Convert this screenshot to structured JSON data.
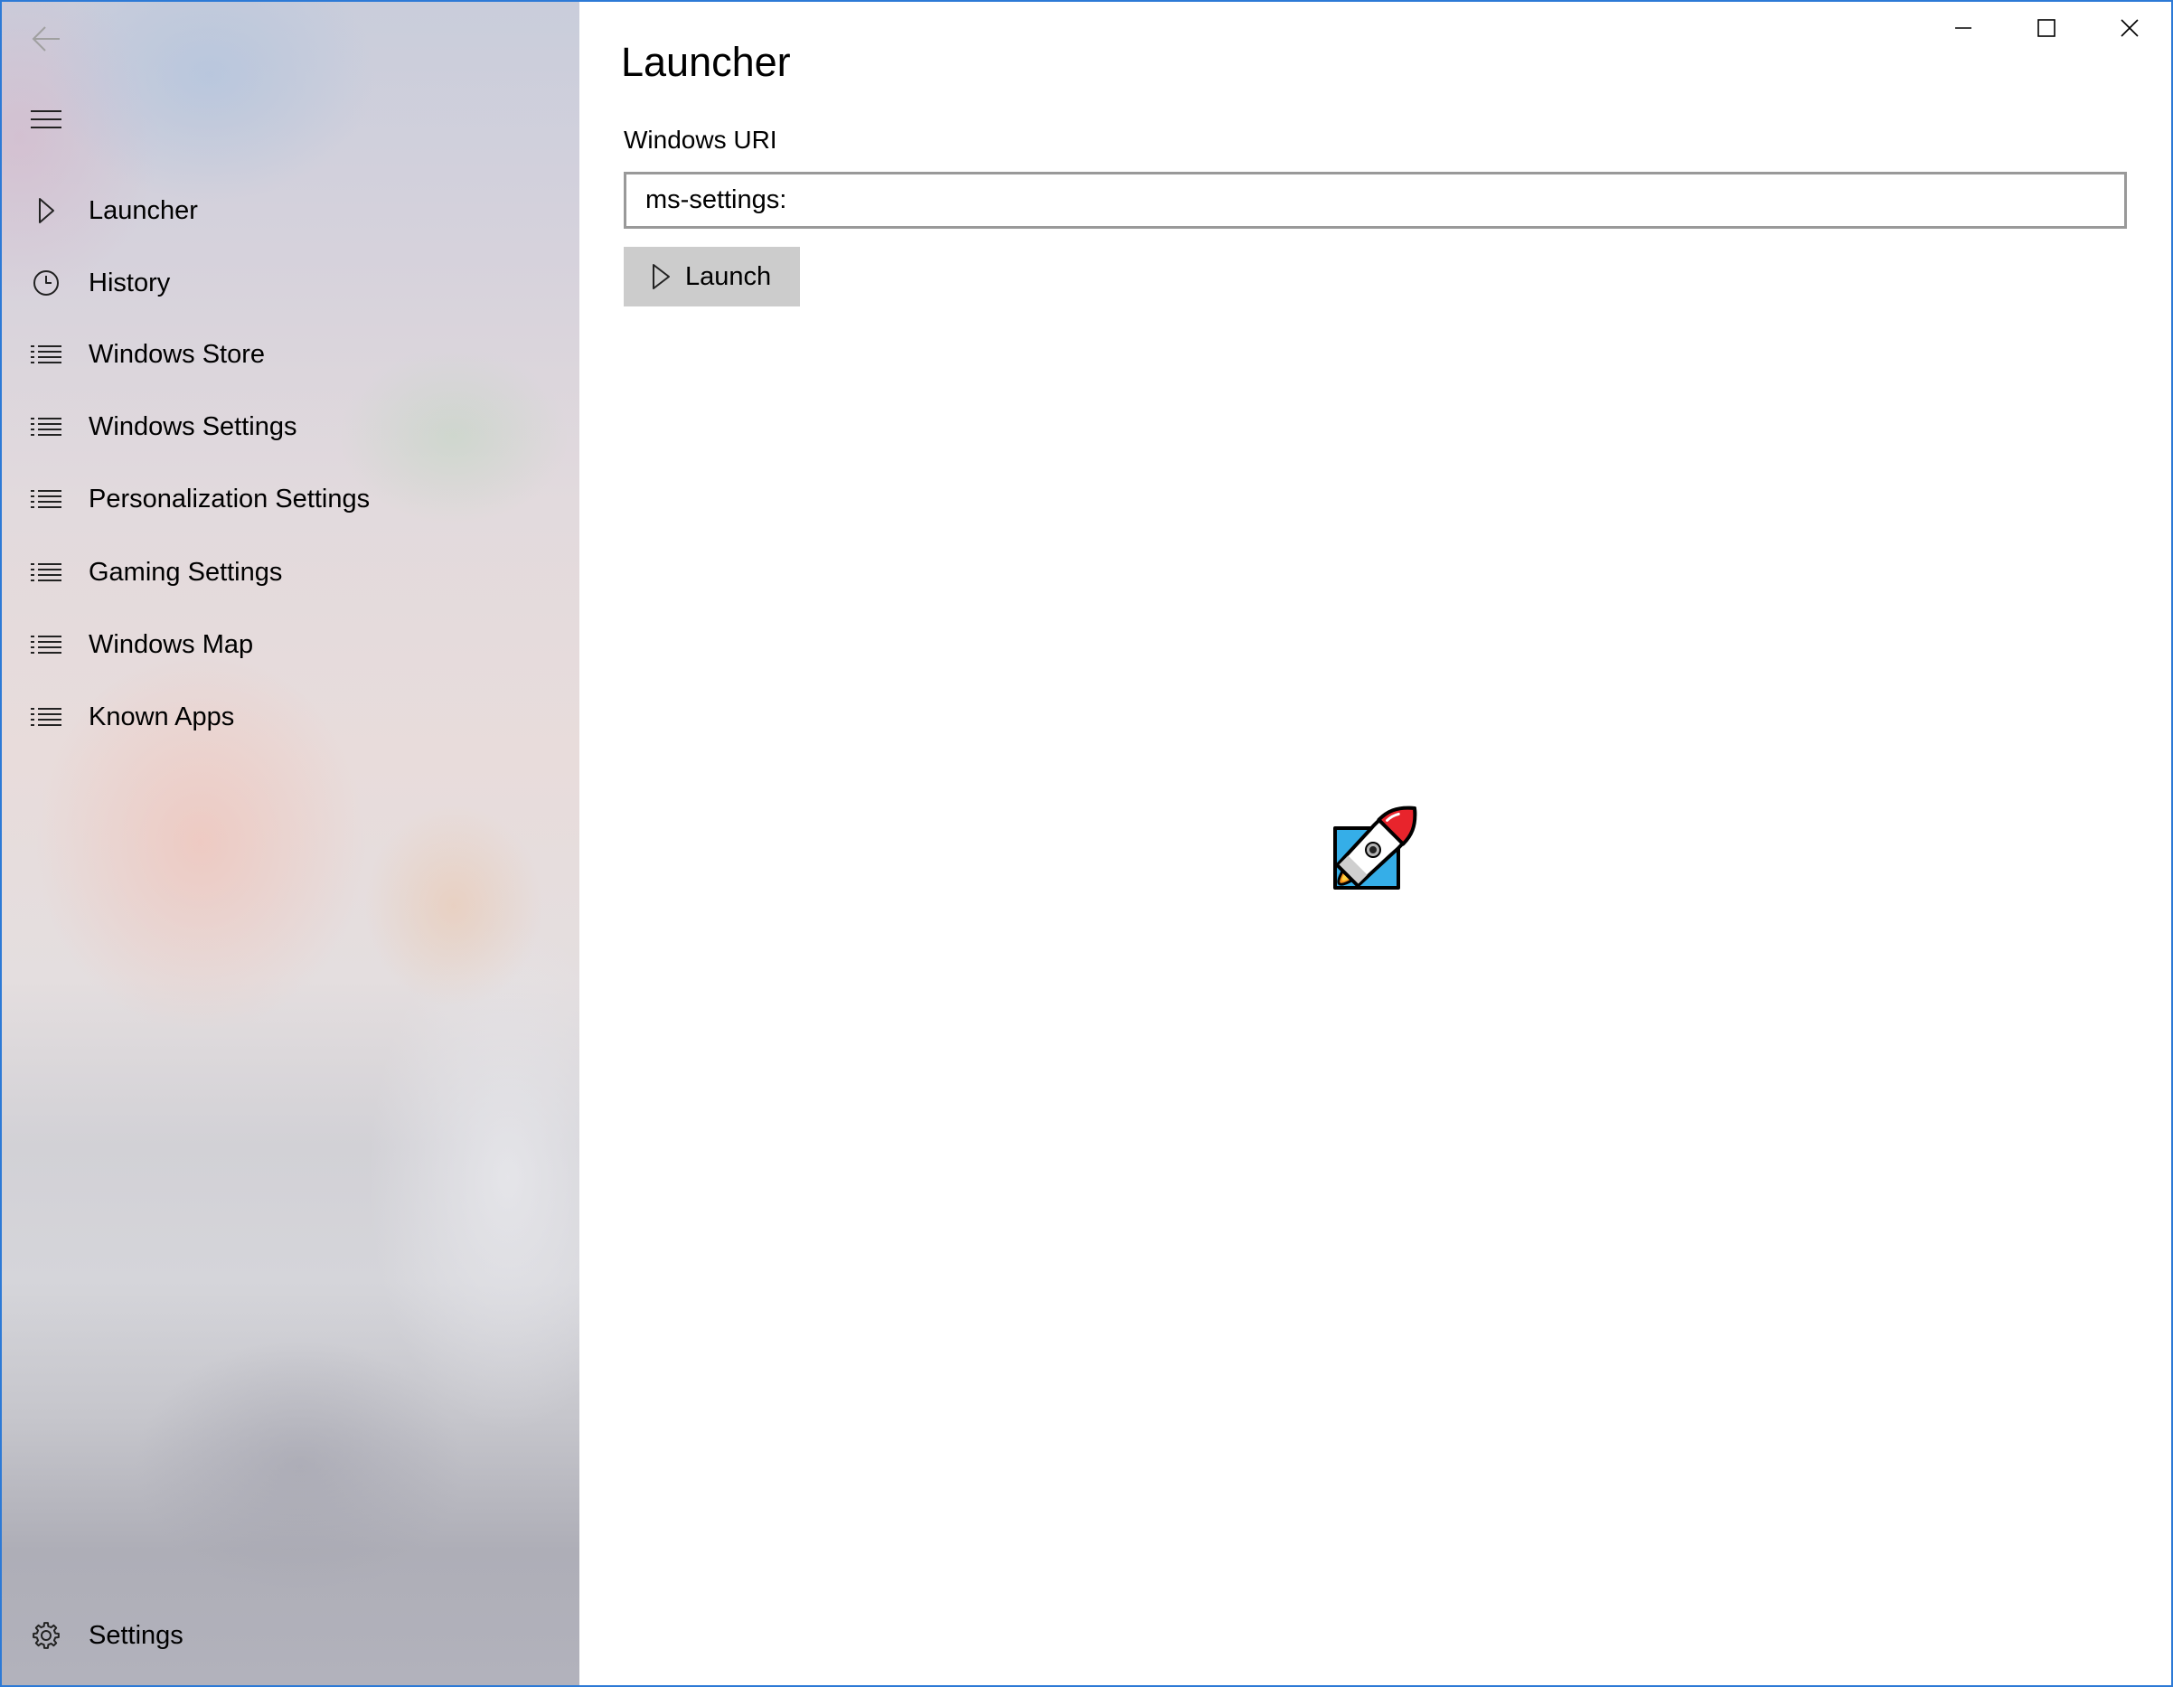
{
  "window": {
    "controls": {
      "minimize_icon": "minimize-icon",
      "maximize_icon": "maximize-icon",
      "close_icon": "close-icon"
    }
  },
  "sidebar": {
    "back_icon": "back-arrow-icon",
    "menu_icon": "hamburger-icon",
    "items": [
      {
        "label": "Launcher",
        "icon": "play-icon"
      },
      {
        "label": "History",
        "icon": "clock-icon"
      },
      {
        "label": "Windows Store",
        "icon": "list-icon"
      },
      {
        "label": "Windows Settings",
        "icon": "list-icon"
      },
      {
        "label": "Personalization Settings",
        "icon": "list-icon"
      },
      {
        "label": "Gaming Settings",
        "icon": "list-icon"
      },
      {
        "label": "Windows Map",
        "icon": "list-icon"
      },
      {
        "label": "Known Apps",
        "icon": "list-icon"
      }
    ],
    "footer": {
      "label": "Settings",
      "icon": "gear-icon"
    }
  },
  "main": {
    "title": "Launcher",
    "uri_field": {
      "label": "Windows URI",
      "value": "ms-settings:"
    },
    "launch_button": {
      "label": "Launch",
      "icon": "play-icon"
    },
    "illustration": {
      "icon": "rocket-icon"
    }
  },
  "colors": {
    "window_border": "#2d7ad6",
    "text": "#000000",
    "disabled_icon": "#a0a0a0",
    "button_background": "#cccccc",
    "input_border": "#999999",
    "rocket_nose": "#e8242c",
    "rocket_fins": "#35aee8",
    "rocket_flame": "#f7941d"
  }
}
